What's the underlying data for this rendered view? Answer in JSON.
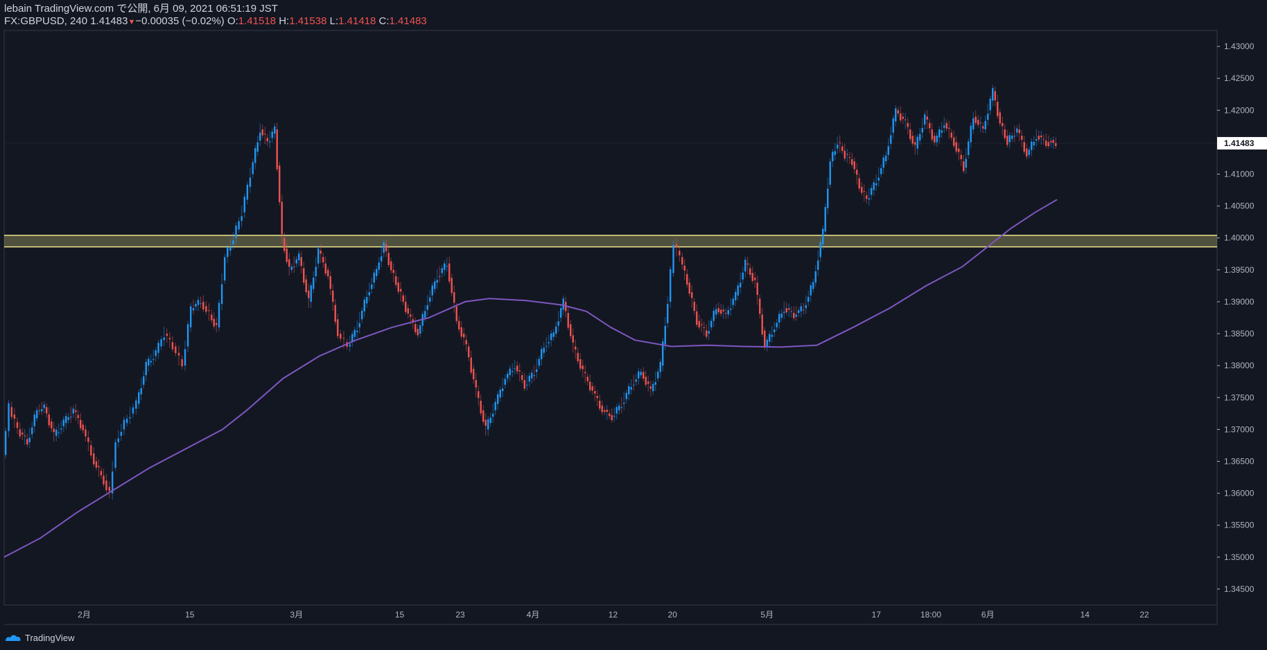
{
  "header": {
    "line1": "lebain TradingView.com で公開, 6月 09, 2021 06:51:19 JST",
    "symbol": "FX:GBPUSD, 240",
    "last": "1.41483",
    "change": "−0.00035 (−0.02%)",
    "o_label": "O:",
    "o_val": "1.41518",
    "h_label": "H:",
    "h_val": "1.41538",
    "l_label": "L:",
    "l_val": "1.41418",
    "c_label": "C:",
    "c_val": "1.41483"
  },
  "footer": {
    "brand": "TradingView"
  },
  "colors": {
    "up": "#2196f3",
    "down": "#ef5350",
    "ma": "#7e57c2",
    "zone": "#f0e68c",
    "bg": "#131722"
  },
  "chart_data": {
    "type": "line",
    "candles_note": "",
    "ylim": [
      1.3425,
      1.4325
    ],
    "y_ticks": [
      "1.43000",
      "1.42500",
      "1.42000",
      "1.41500",
      "1.41000",
      "1.40500",
      "1.40000",
      "1.39500",
      "1.39000",
      "1.38500",
      "1.38000",
      "1.37500",
      "1.37000",
      "1.36500",
      "1.36000",
      "1.35500",
      "1.35000",
      "1.34500"
    ],
    "y_tick_values": [
      1.43,
      1.425,
      1.42,
      1.415,
      1.41,
      1.405,
      1.4,
      1.395,
      1.39,
      1.385,
      1.38,
      1.375,
      1.37,
      1.365,
      1.36,
      1.355,
      1.35,
      1.345
    ],
    "x_ticks": [
      "2月",
      "15",
      "3月",
      "15",
      "23",
      "4月",
      "12",
      "20",
      "5月",
      "17",
      "18:00",
      "6月",
      "14",
      "22"
    ],
    "x_tick_pos": [
      0.066,
      0.153,
      0.241,
      0.326,
      0.376,
      0.436,
      0.502,
      0.551,
      0.629,
      0.719,
      0.764,
      0.811,
      0.891,
      0.94
    ],
    "last_price_label": "1.41483",
    "last_price": 1.41483,
    "zone": {
      "top": 1.4004,
      "bottom": 1.3986
    },
    "price_path": [
      {
        "t": 0.0,
        "p": 1.366
      },
      {
        "t": 0.005,
        "p": 1.3735
      },
      {
        "t": 0.012,
        "p": 1.37
      },
      {
        "t": 0.02,
        "p": 1.368
      },
      {
        "t": 0.028,
        "p": 1.373
      },
      {
        "t": 0.034,
        "p": 1.3735
      },
      {
        "t": 0.042,
        "p": 1.369
      },
      {
        "t": 0.05,
        "p": 1.371
      },
      {
        "t": 0.058,
        "p": 1.373
      },
      {
        "t": 0.066,
        "p": 1.37
      },
      {
        "t": 0.075,
        "p": 1.365
      },
      {
        "t": 0.083,
        "p": 1.362
      },
      {
        "t": 0.088,
        "p": 1.36
      },
      {
        "t": 0.093,
        "p": 1.368
      },
      {
        "t": 0.1,
        "p": 1.371
      },
      {
        "t": 0.11,
        "p": 1.374
      },
      {
        "t": 0.118,
        "p": 1.38
      },
      {
        "t": 0.126,
        "p": 1.382
      },
      {
        "t": 0.133,
        "p": 1.385
      },
      {
        "t": 0.14,
        "p": 1.383
      },
      {
        "t": 0.148,
        "p": 1.38
      },
      {
        "t": 0.155,
        "p": 1.389
      },
      {
        "t": 0.163,
        "p": 1.39
      },
      {
        "t": 0.17,
        "p": 1.388
      },
      {
        "t": 0.176,
        "p": 1.386
      },
      {
        "t": 0.183,
        "p": 1.397
      },
      {
        "t": 0.19,
        "p": 1.4
      },
      {
        "t": 0.197,
        "p": 1.404
      },
      {
        "t": 0.204,
        "p": 1.41
      },
      {
        "t": 0.212,
        "p": 1.417
      },
      {
        "t": 0.218,
        "p": 1.415
      },
      {
        "t": 0.224,
        "p": 1.417
      },
      {
        "t": 0.23,
        "p": 1.4
      },
      {
        "t": 0.236,
        "p": 1.395
      },
      {
        "t": 0.244,
        "p": 1.397
      },
      {
        "t": 0.252,
        "p": 1.39
      },
      {
        "t": 0.26,
        "p": 1.398
      },
      {
        "t": 0.268,
        "p": 1.394
      },
      {
        "t": 0.276,
        "p": 1.385
      },
      {
        "t": 0.284,
        "p": 1.383
      },
      {
        "t": 0.292,
        "p": 1.386
      },
      {
        "t": 0.3,
        "p": 1.391
      },
      {
        "t": 0.308,
        "p": 1.395
      },
      {
        "t": 0.314,
        "p": 1.399
      },
      {
        "t": 0.32,
        "p": 1.395
      },
      {
        "t": 0.326,
        "p": 1.392
      },
      {
        "t": 0.334,
        "p": 1.388
      },
      {
        "t": 0.342,
        "p": 1.385
      },
      {
        "t": 0.35,
        "p": 1.39
      },
      {
        "t": 0.358,
        "p": 1.394
      },
      {
        "t": 0.366,
        "p": 1.396
      },
      {
        "t": 0.374,
        "p": 1.387
      },
      {
        "t": 0.382,
        "p": 1.383
      },
      {
        "t": 0.39,
        "p": 1.376
      },
      {
        "t": 0.398,
        "p": 1.37
      },
      {
        "t": 0.406,
        "p": 1.374
      },
      {
        "t": 0.414,
        "p": 1.378
      },
      {
        "t": 0.422,
        "p": 1.38
      },
      {
        "t": 0.43,
        "p": 1.377
      },
      {
        "t": 0.438,
        "p": 1.379
      },
      {
        "t": 0.446,
        "p": 1.383
      },
      {
        "t": 0.454,
        "p": 1.385
      },
      {
        "t": 0.462,
        "p": 1.39
      },
      {
        "t": 0.47,
        "p": 1.383
      },
      {
        "t": 0.478,
        "p": 1.379
      },
      {
        "t": 0.486,
        "p": 1.376
      },
      {
        "t": 0.494,
        "p": 1.373
      },
      {
        "t": 0.502,
        "p": 1.372
      },
      {
        "t": 0.51,
        "p": 1.374
      },
      {
        "t": 0.518,
        "p": 1.377
      },
      {
        "t": 0.526,
        "p": 1.379
      },
      {
        "t": 0.534,
        "p": 1.376
      },
      {
        "t": 0.542,
        "p": 1.38
      },
      {
        "t": 0.548,
        "p": 1.39
      },
      {
        "t": 0.553,
        "p": 1.399
      },
      {
        "t": 0.558,
        "p": 1.397
      },
      {
        "t": 0.564,
        "p": 1.393
      },
      {
        "t": 0.572,
        "p": 1.387
      },
      {
        "t": 0.58,
        "p": 1.385
      },
      {
        "t": 0.588,
        "p": 1.389
      },
      {
        "t": 0.596,
        "p": 1.388
      },
      {
        "t": 0.604,
        "p": 1.391
      },
      {
        "t": 0.612,
        "p": 1.396
      },
      {
        "t": 0.62,
        "p": 1.393
      },
      {
        "t": 0.628,
        "p": 1.383
      },
      {
        "t": 0.636,
        "p": 1.386
      },
      {
        "t": 0.644,
        "p": 1.389
      },
      {
        "t": 0.652,
        "p": 1.388
      },
      {
        "t": 0.66,
        "p": 1.389
      },
      {
        "t": 0.668,
        "p": 1.393
      },
      {
        "t": 0.676,
        "p": 1.401
      },
      {
        "t": 0.682,
        "p": 1.412
      },
      {
        "t": 0.688,
        "p": 1.415
      },
      {
        "t": 0.694,
        "p": 1.413
      },
      {
        "t": 0.7,
        "p": 1.412
      },
      {
        "t": 0.706,
        "p": 1.408
      },
      {
        "t": 0.712,
        "p": 1.406
      },
      {
        "t": 0.72,
        "p": 1.409
      },
      {
        "t": 0.728,
        "p": 1.413
      },
      {
        "t": 0.736,
        "p": 1.42
      },
      {
        "t": 0.744,
        "p": 1.418
      },
      {
        "t": 0.752,
        "p": 1.414
      },
      {
        "t": 0.76,
        "p": 1.419
      },
      {
        "t": 0.768,
        "p": 1.415
      },
      {
        "t": 0.776,
        "p": 1.418
      },
      {
        "t": 0.784,
        "p": 1.415
      },
      {
        "t": 0.792,
        "p": 1.411
      },
      {
        "t": 0.8,
        "p": 1.419
      },
      {
        "t": 0.808,
        "p": 1.417
      },
      {
        "t": 0.816,
        "p": 1.423
      },
      {
        "t": 0.822,
        "p": 1.418
      },
      {
        "t": 0.828,
        "p": 1.415
      },
      {
        "t": 0.836,
        "p": 1.417
      },
      {
        "t": 0.844,
        "p": 1.413
      },
      {
        "t": 0.852,
        "p": 1.416
      },
      {
        "t": 0.86,
        "p": 1.415
      },
      {
        "t": 0.868,
        "p": 1.4148
      }
    ],
    "ma_path": [
      {
        "t": 0.0,
        "p": 1.35
      },
      {
        "t": 0.03,
        "p": 1.353
      },
      {
        "t": 0.06,
        "p": 1.357
      },
      {
        "t": 0.09,
        "p": 1.3605
      },
      {
        "t": 0.12,
        "p": 1.364
      },
      {
        "t": 0.15,
        "p": 1.367
      },
      {
        "t": 0.18,
        "p": 1.37
      },
      {
        "t": 0.2,
        "p": 1.373
      },
      {
        "t": 0.23,
        "p": 1.378
      },
      {
        "t": 0.26,
        "p": 1.3815
      },
      {
        "t": 0.29,
        "p": 1.384
      },
      {
        "t": 0.32,
        "p": 1.386
      },
      {
        "t": 0.35,
        "p": 1.3875
      },
      {
        "t": 0.38,
        "p": 1.39
      },
      {
        "t": 0.4,
        "p": 1.3905
      },
      {
        "t": 0.43,
        "p": 1.3902
      },
      {
        "t": 0.46,
        "p": 1.3895
      },
      {
        "t": 0.48,
        "p": 1.3885
      },
      {
        "t": 0.5,
        "p": 1.386
      },
      {
        "t": 0.52,
        "p": 1.384
      },
      {
        "t": 0.55,
        "p": 1.383
      },
      {
        "t": 0.58,
        "p": 1.3832
      },
      {
        "t": 0.61,
        "p": 1.383
      },
      {
        "t": 0.64,
        "p": 1.3829
      },
      {
        "t": 0.67,
        "p": 1.3832
      },
      {
        "t": 0.7,
        "p": 1.386
      },
      {
        "t": 0.73,
        "p": 1.389
      },
      {
        "t": 0.76,
        "p": 1.3925
      },
      {
        "t": 0.79,
        "p": 1.3955
      },
      {
        "t": 0.81,
        "p": 1.3985
      },
      {
        "t": 0.83,
        "p": 1.4015
      },
      {
        "t": 0.85,
        "p": 1.404
      },
      {
        "t": 0.868,
        "p": 1.406
      }
    ]
  }
}
